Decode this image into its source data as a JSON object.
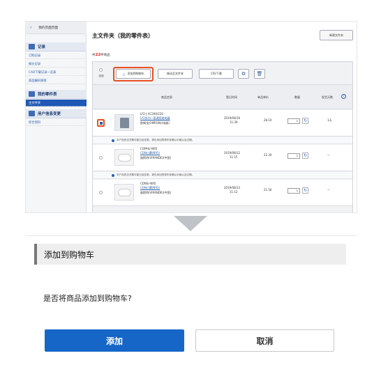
{
  "screenshot": {
    "sidebar": {
      "top_link": "我的页面页面",
      "sections": [
        {
          "label": "记录",
          "items": [
            "订购记录",
            "报价记录",
            "CAD下载记录一览表",
            "部品编码调查"
          ]
        },
        {
          "label": "我的零件表",
          "items": [
            "主文件夹"
          ]
        },
        {
          "label": "用户信息变更",
          "items": [
            "综合资料"
          ]
        }
      ]
    },
    "main": {
      "title": "主文件夹（我的零件表）",
      "new_folder_button": "新建文件夹",
      "count_prefix": "共",
      "count_value": "22",
      "count_suffix": "件商品",
      "toolbar": {
        "select_all": "全选",
        "add_to_cart": "添加到购物车",
        "move_folder": "移动至文件夹",
        "csv": "CSV下载"
      },
      "headers": {
        "product": "商品信息",
        "date": "登记时间",
        "price": "单品单价",
        "qty": "数量",
        "ship": "发货天数"
      },
      "rows": [
        {
          "model": "LY2-J AC200/220",
          "name": "LY2系列一段通用继电器",
          "brand": "欧姆龙(OMRON)(电器)",
          "date": "2019/08/16",
          "time": "11:39",
          "price": "28.10",
          "qty": "1",
          "ship": "1天",
          "checked": true
        },
        {
          "notice": "本产品的交货期可能已经变更。请在添加购物车前确认价格以及交期。"
        },
        {
          "model": "COPA4/-N95",
          "name": "CDN口罩(N95)",
          "brand": "维斯特(VIRANDE)(中国)",
          "date": "2019/08/12",
          "time": "11:15",
          "price": "22.30",
          "qty": "1",
          "ship": "—",
          "checked": false
        },
        {
          "notice": "本产品的交货期可能已经变更。请在添加购物车前确认价格以及交期。"
        },
        {
          "model": "CDNS/-N95",
          "name": "CDN口罩(N95)",
          "brand": "维斯特(VIRANDE)(中国)",
          "date": "2019/08/13",
          "time": "11:12",
          "price": "21.50",
          "qty": "1",
          "ship": "—",
          "checked": false
        }
      ]
    }
  },
  "dialog": {
    "title": "添加到购物车",
    "message": "是否将商品添加到购物车?",
    "confirm_label": "添加",
    "cancel_label": "取消"
  },
  "colors": {
    "accent": "#1666c7",
    "highlight": "#e8501f",
    "price_count": "#d21f1f"
  }
}
